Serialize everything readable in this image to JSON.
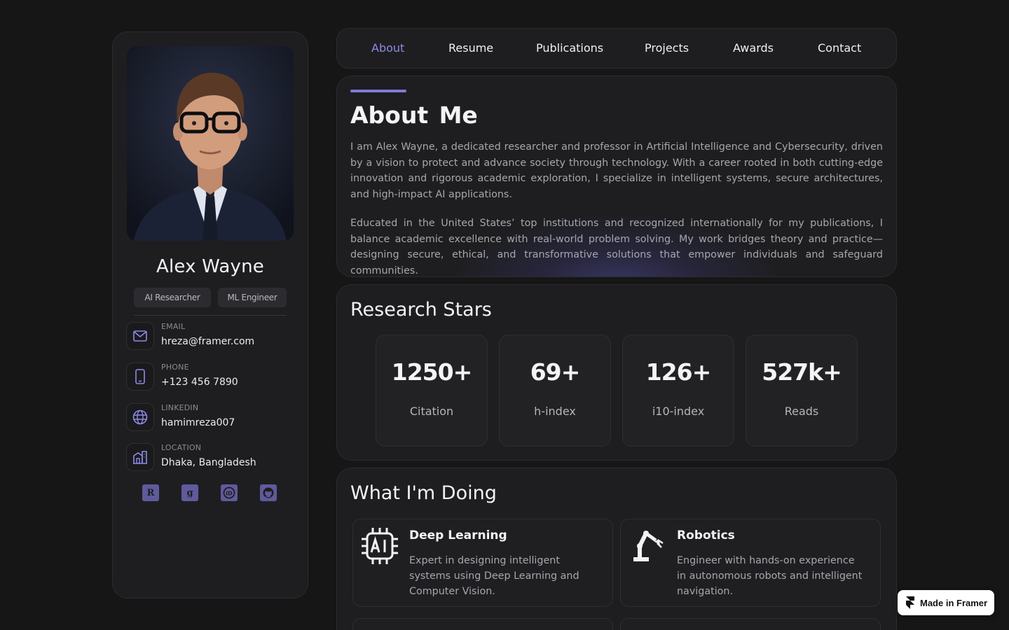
{
  "profile": {
    "name": "Alex Wayne",
    "tags": [
      "AI Researcher",
      "ML Engineer"
    ],
    "contacts": [
      {
        "label": "EMAIL",
        "value": "hreza@framer.com",
        "icon": "mail-icon"
      },
      {
        "label": "PHONE",
        "value": "+123 456 7890",
        "icon": "phone-icon"
      },
      {
        "label": "LINKEDIN",
        "value": "hamimreza007",
        "icon": "globe-icon"
      },
      {
        "label": "LOCATION",
        "value": "Dhaka, Bangladesh",
        "icon": "building-icon"
      }
    ],
    "socials": [
      {
        "icon": "researchgate-icon",
        "glyph": "R"
      },
      {
        "icon": "google-scholar-icon",
        "glyph": "g"
      },
      {
        "icon": "orcid-icon",
        "glyph": "iD"
      },
      {
        "icon": "github-icon",
        "glyph": "●"
      }
    ]
  },
  "nav": {
    "items": [
      "About",
      "Resume",
      "Publications",
      "Projects",
      "Awards",
      "Contact"
    ],
    "active": "About"
  },
  "about": {
    "title": "About Me",
    "paragraphs": [
      "I am Alex Wayne, a dedicated researcher and professor in Artificial Intelligence and Cybersecurity, driven by a vision to protect and advance society through technology. With a career rooted in both cutting-edge innovation and rigorous academic exploration, I specialize in intelligent systems, secure architectures, and high-impact AI applications.",
      "Educated in the United States’ top institutions and recognized internationally for my publications, I balance academic excellence with real-world problem solving. My work bridges theory and practice—designing secure, ethical, and transformative solutions that empower individuals and safeguard communities."
    ]
  },
  "research": {
    "title": "Research Stars",
    "stats": [
      {
        "value": "1250+",
        "label": "Citation"
      },
      {
        "value": "69+",
        "label": "h-index"
      },
      {
        "value": "126+",
        "label": "i10-index"
      },
      {
        "value": "527k+",
        "label": "Reads"
      }
    ]
  },
  "doing": {
    "title": "What I'm Doing",
    "services": [
      {
        "title": "Deep Learning",
        "desc": "Expert in designing intelligent systems using Deep Learning and Computer Vision.",
        "icon": "ai-chip-icon"
      },
      {
        "title": "Robotics",
        "desc": "Engineer with hands-on experience in autonomous robots and intelligent navigation.",
        "icon": "robot-arm-icon"
      }
    ]
  },
  "badge": {
    "label": "Made in Framer",
    "icon": "framer-icon"
  },
  "colors": {
    "accent": "#8e8ae6",
    "background": "#161617",
    "card": "#1e1e20",
    "social": "#5f5a9c"
  }
}
